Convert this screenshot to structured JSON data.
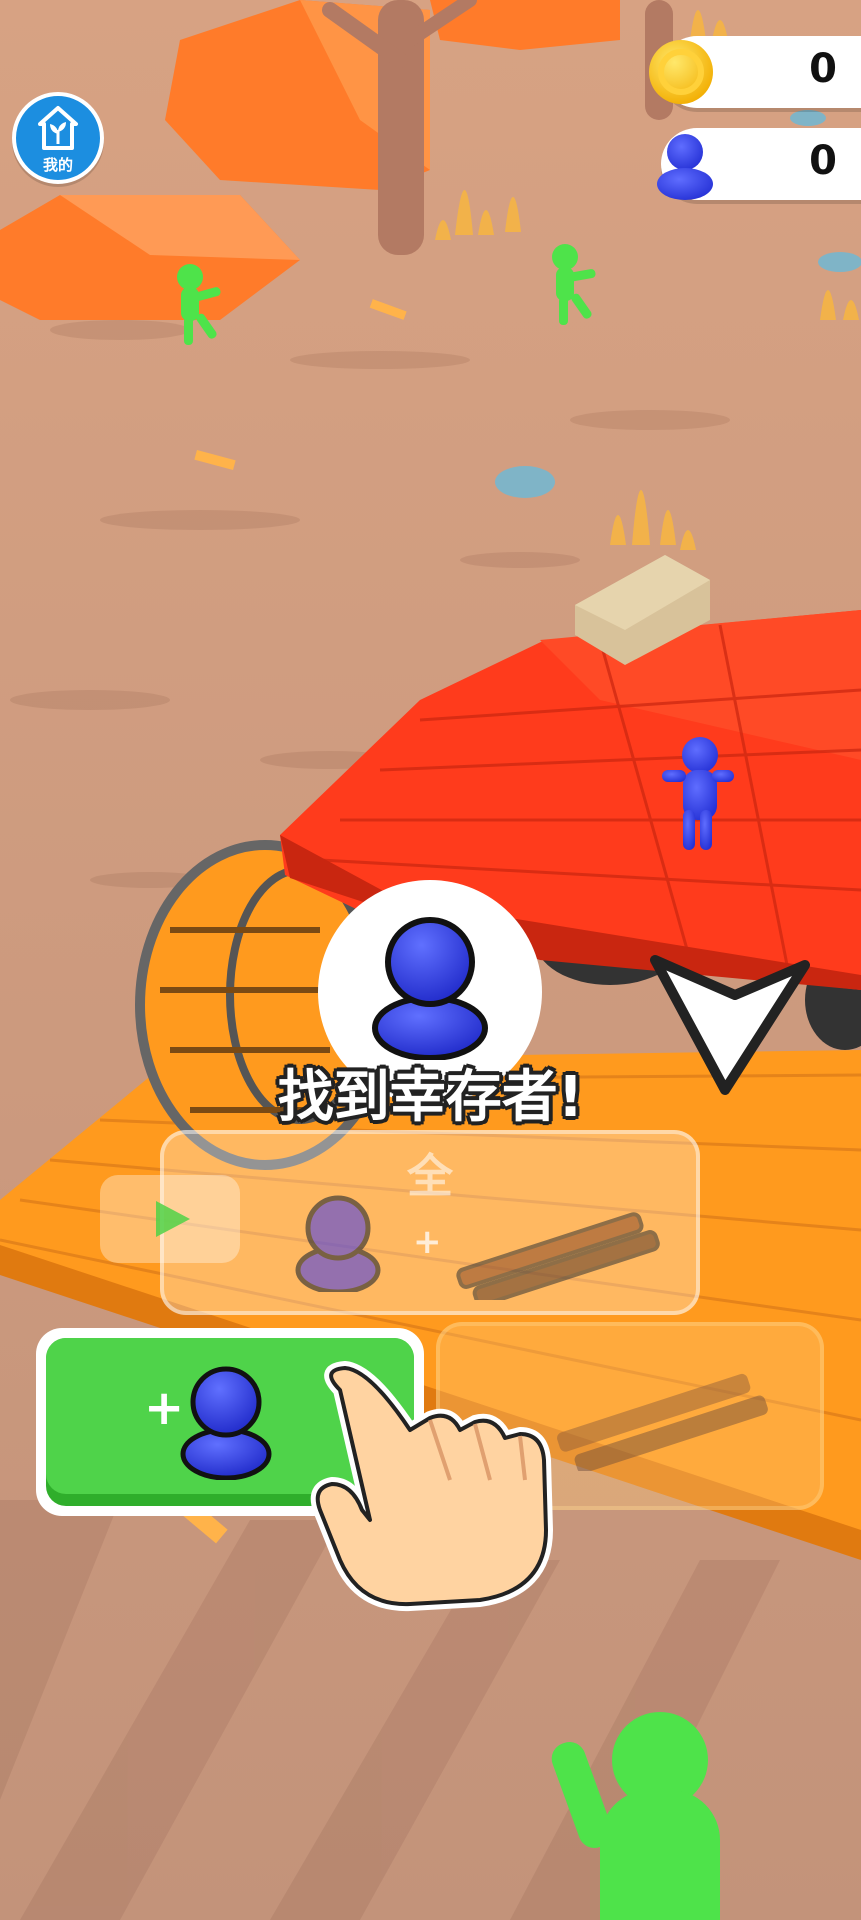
{
  "hud": {
    "coins": "0",
    "survivors": "0",
    "coin_icon": "gold-coin-icon",
    "survivor_icon": "blue-person-icon"
  },
  "home": {
    "label": "我的",
    "icon": "house-with-plant-icon"
  },
  "popup": {
    "title": "找到幸存者!",
    "icon": "blue-person-icon"
  },
  "choice_ghost": {
    "label": "全",
    "plus": "+",
    "icons": [
      "play-icon",
      "person-icon",
      "rifles-icon"
    ]
  },
  "actions": {
    "add_survivor_plus": "+",
    "add_survivor_icon": "blue-person-icon",
    "weapons_icon": "rifles-icon",
    "hint_icon": "pointing-hand-icon"
  },
  "colors": {
    "ground": "#c99a7a",
    "accent_green": "#4fd34a",
    "survivor_blue": "#3546f0",
    "truck_red": "#ff3b1c",
    "ramp_orange": "#ff9a1e",
    "home_blue": "#1c8ee0"
  }
}
